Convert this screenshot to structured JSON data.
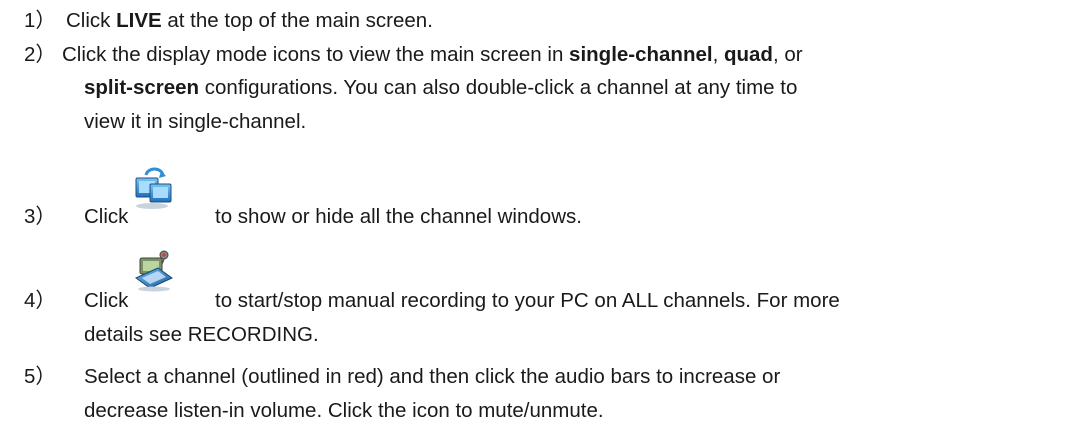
{
  "steps": [
    {
      "number": "1）",
      "pre": "Click ",
      "bold": "LIVE",
      "post": " at the top of the main screen."
    },
    {
      "number": "2）",
      "line1_pre": "Click the display mode icons to view the main screen in ",
      "bold1": "single-channel",
      "sep1": ", ",
      "bold2": "quad",
      "sep2": ", or",
      "bold3": "split-screen",
      "line2_post": " configurations. You can also double-click a channel at any time to",
      "line3": "view it in single-channel."
    },
    {
      "number": "3）",
      "pre": "Click",
      "icon": "show-hide-windows-icon",
      "post": "to show or hide all the channel windows."
    },
    {
      "number": "4）",
      "pre": "Click",
      "icon": "manual-record-icon",
      "post": "to start/stop manual recording to your PC on ALL channels. For more",
      "line2": "details see RECORDING."
    },
    {
      "number": "5）",
      "line1": "Select a channel (outlined in red) and then click the audio bars to increase or",
      "line2": "decrease listen-in volume. Click the icon to mute/unmute."
    }
  ]
}
